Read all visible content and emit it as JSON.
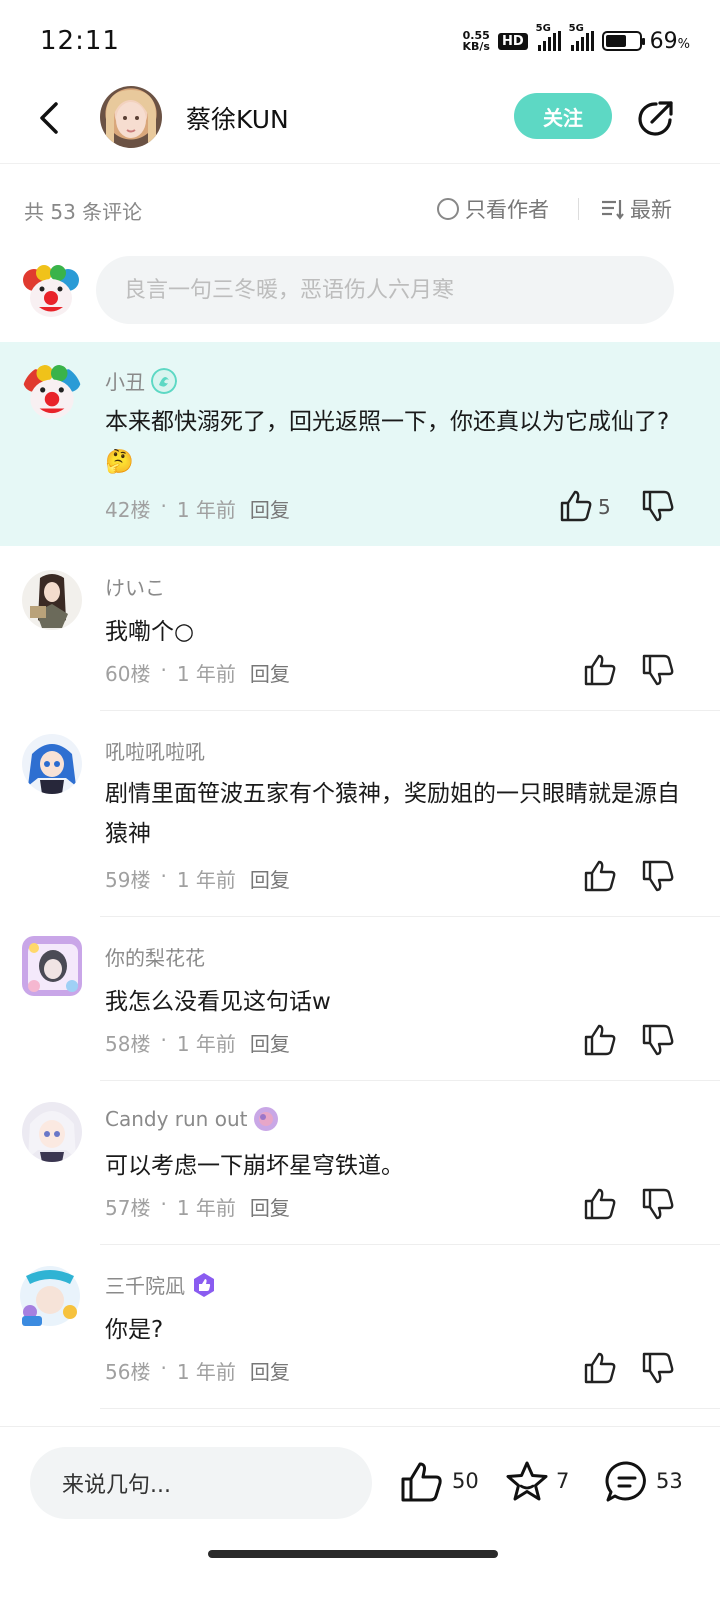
{
  "status_bar": {
    "time": "12:11",
    "net_speed_value": "0.55",
    "net_speed_unit": "KB/s",
    "hd": "HD",
    "signal1": "5G",
    "signal2": "5G",
    "battery": "69",
    "battery_unit": "%"
  },
  "header": {
    "author": "蔡徐KUN",
    "follow_label": "关注"
  },
  "filter": {
    "count_label": "共 53 条评论",
    "only_author_label": "只看作者",
    "sort_label": "最新"
  },
  "comment_input": {
    "placeholder": "良言一句三冬暖，恶语伤人六月寒"
  },
  "comments": [
    {
      "name": "小丑",
      "text": "本来都快溺死了，回光返照一下，你还真以为它成仙了?",
      "floor": "42楼",
      "time": "1 年前",
      "reply": "回复",
      "likes": "5"
    },
    {
      "name": "けいこ",
      "text": "我嘞个○",
      "floor": "60楼",
      "time": "1 年前",
      "reply": "回复"
    },
    {
      "name": "吼啦吼啦吼",
      "text": "剧情里面笹波五家有个猿神，奖励姐的一只眼睛就是源自猿神",
      "floor": "59楼",
      "time": "1 年前",
      "reply": "回复"
    },
    {
      "name": "你的梨花花",
      "text": "我怎么没看见这句话w",
      "floor": "58楼",
      "time": "1 年前",
      "reply": "回复"
    },
    {
      "name": "Candy run out",
      "text": "可以考虑一下崩坏星穹铁道。",
      "floor": "57楼",
      "time": "1 年前",
      "reply": "回复"
    },
    {
      "name": "三千院凪",
      "text": "你是?",
      "floor": "56楼",
      "time": "1 年前",
      "reply": "回复"
    }
  ],
  "bottom_bar": {
    "say_label": "来说几句...",
    "likes": "50",
    "favorites": "7",
    "comments": "53"
  },
  "colors": {
    "accent": "#5dd8c4",
    "highlight_bg": "#e6f8f6"
  }
}
